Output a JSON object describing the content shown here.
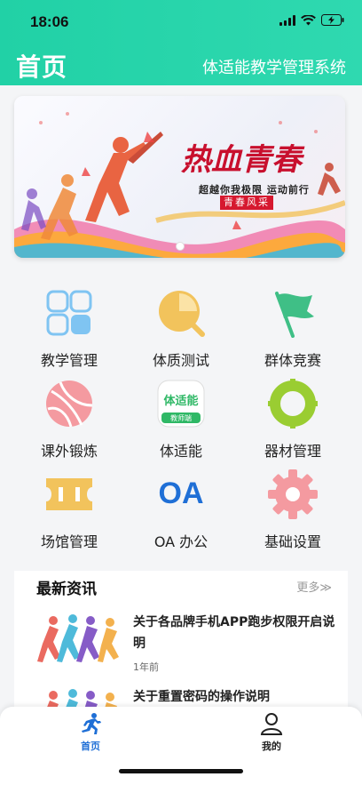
{
  "status_bar": {
    "time": "18:06"
  },
  "header": {
    "title": "首页",
    "system_name": "体适能教学管理系统"
  },
  "banner": {
    "title": "热血青春",
    "slogan": "超越你我极限 运动前行",
    "tag": "青春风采"
  },
  "grid": [
    {
      "label": "教学管理",
      "icon": "grid-blocks-icon"
    },
    {
      "label": "体质测试",
      "icon": "search-magnifier-icon"
    },
    {
      "label": "群体竞赛",
      "icon": "flag-icon"
    },
    {
      "label": "课外锻炼",
      "icon": "basketball-icon"
    },
    {
      "label": "体适能",
      "icon": "app-logo-icon",
      "badge_text": "体适能",
      "badge_sub": "教师端"
    },
    {
      "label": "器材管理",
      "icon": "target-ring-icon"
    },
    {
      "label": "场馆管理",
      "icon": "venue-icon"
    },
    {
      "label": "OA 办公",
      "icon": "oa-icon",
      "icon_text": "OA"
    },
    {
      "label": "基础设置",
      "icon": "gear-icon"
    }
  ],
  "news": {
    "heading": "最新资讯",
    "more": "更多≫",
    "items": [
      {
        "title": "关于各品牌手机APP跑步权限开启说明",
        "time": "1年前"
      },
      {
        "title": "关于重置密码的操作说明",
        "time": ""
      }
    ]
  },
  "tabbar": {
    "tabs": [
      {
        "label": "首页",
        "icon": "runner-icon",
        "active": true
      },
      {
        "label": "我的",
        "icon": "user-icon",
        "active": false
      }
    ]
  },
  "colors": {
    "header_gradient_start": "#21d1a6",
    "accent_blue": "#1f6fd6",
    "blue_icon": "#7fc4f2",
    "yellow_icon": "#f2c35c",
    "green_icon": "#3fbf86",
    "pink_icon": "#f49aa0",
    "lime_icon": "#9acd32"
  }
}
